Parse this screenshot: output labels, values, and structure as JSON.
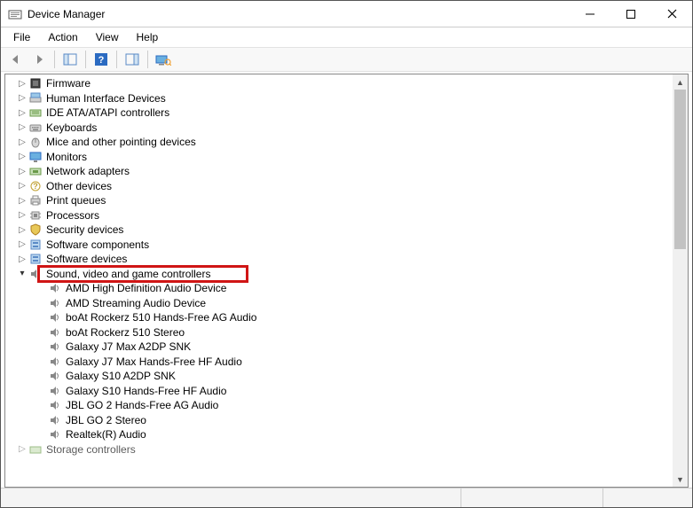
{
  "window": {
    "title": "Device Manager"
  },
  "menu": {
    "file": "File",
    "action": "Action",
    "view": "View",
    "help": "Help"
  },
  "categories": [
    {
      "name": "Firmware",
      "icon": "firmware-icon",
      "expanded": false
    },
    {
      "name": "Human Interface Devices",
      "icon": "hid-icon",
      "expanded": false
    },
    {
      "name": "IDE ATA/ATAPI controllers",
      "icon": "ide-icon",
      "expanded": false
    },
    {
      "name": "Keyboards",
      "icon": "keyboard-icon",
      "expanded": false
    },
    {
      "name": "Mice and other pointing devices",
      "icon": "mouse-icon",
      "expanded": false
    },
    {
      "name": "Monitors",
      "icon": "monitor-icon",
      "expanded": false
    },
    {
      "name": "Network adapters",
      "icon": "network-icon",
      "expanded": false
    },
    {
      "name": "Other devices",
      "icon": "other-icon",
      "expanded": false
    },
    {
      "name": "Print queues",
      "icon": "printer-icon",
      "expanded": false
    },
    {
      "name": "Processors",
      "icon": "processor-icon",
      "expanded": false
    },
    {
      "name": "Security devices",
      "icon": "security-icon",
      "expanded": false
    },
    {
      "name": "Software components",
      "icon": "software-component-icon",
      "expanded": false
    },
    {
      "name": "Software devices",
      "icon": "software-device-icon",
      "expanded": false
    },
    {
      "name": "Sound, video and game controllers",
      "icon": "sound-icon",
      "expanded": true,
      "highlighted": true,
      "children": [
        "AMD High Definition Audio Device",
        "AMD Streaming Audio Device",
        "boAt Rockerz 510 Hands-Free AG Audio",
        "boAt Rockerz 510 Stereo",
        "Galaxy J7 Max A2DP SNK",
        "Galaxy J7 Max Hands-Free HF Audio",
        "Galaxy S10 A2DP SNK",
        "Galaxy S10 Hands-Free HF Audio",
        "JBL GO 2 Hands-Free AG Audio",
        "JBL GO 2 Stereo",
        "Realtek(R) Audio"
      ]
    },
    {
      "name": "Storage controllers",
      "icon": "storage-icon",
      "expanded": false
    }
  ]
}
